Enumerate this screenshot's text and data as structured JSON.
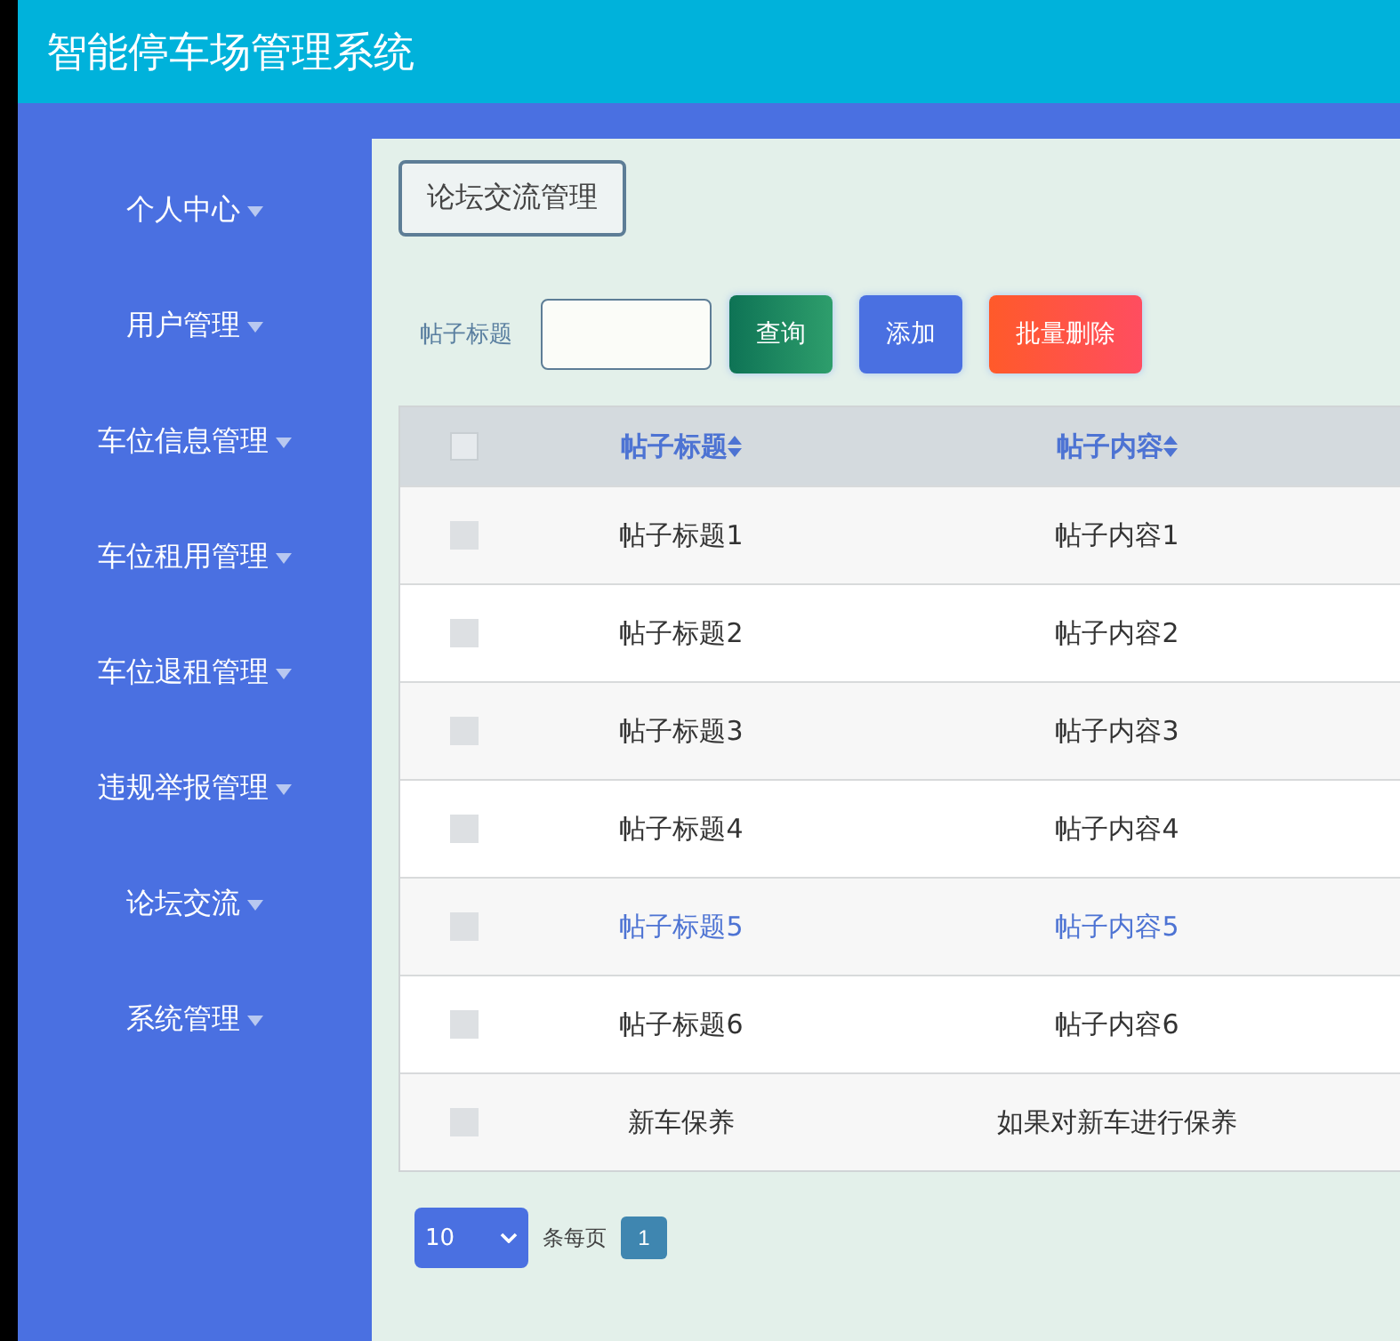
{
  "app_title": "智能停车场管理系统",
  "sidebar": {
    "items": [
      {
        "label": "个人中心",
        "expanded": false
      },
      {
        "label": "用户管理",
        "expanded": false
      },
      {
        "label": "车位信息管理",
        "expanded": false
      },
      {
        "label": "车位租用管理",
        "expanded": false
      },
      {
        "label": "车位退租管理",
        "expanded": false
      },
      {
        "label": "违规举报管理",
        "expanded": false
      },
      {
        "label": "论坛交流",
        "expanded": false
      },
      {
        "label": "系统管理",
        "expanded": false
      }
    ]
  },
  "page_title": "论坛交流管理",
  "search": {
    "label": "帖子标题",
    "buttons": [
      {
        "label": "查询",
        "kind": "query"
      },
      {
        "label": "添加",
        "kind": "add"
      },
      {
        "label": "批量删除",
        "kind": "delete"
      }
    ]
  },
  "table": {
    "select_all_checked": false,
    "columns": [
      "帖子标题",
      "帖子内容"
    ],
    "rows": [
      {
        "cells": [
          "帖子标题1",
          "帖子内容1"
        ],
        "checked": false,
        "hovered": false
      },
      {
        "cells": [
          "帖子标题2",
          "帖子内容2"
        ],
        "checked": false,
        "hovered": false
      },
      {
        "cells": [
          "帖子标题3",
          "帖子内容3"
        ],
        "checked": false,
        "hovered": false
      },
      {
        "cells": [
          "帖子标题4",
          "帖子内容4"
        ],
        "checked": false,
        "hovered": false
      },
      {
        "cells": [
          "帖子标题5",
          "帖子内容5"
        ],
        "checked": false,
        "hovered": true
      },
      {
        "cells": [
          "帖子标题6",
          "帖子内容6"
        ],
        "checked": false,
        "hovered": false
      },
      {
        "cells": [
          "新车保养",
          "如果对新车进行保养"
        ],
        "checked": false,
        "hovered": false
      }
    ]
  },
  "pagination": {
    "page_size": "10",
    "page_size_label": "条每页",
    "pages": [
      {
        "label": "1",
        "selected": true
      }
    ]
  }
}
